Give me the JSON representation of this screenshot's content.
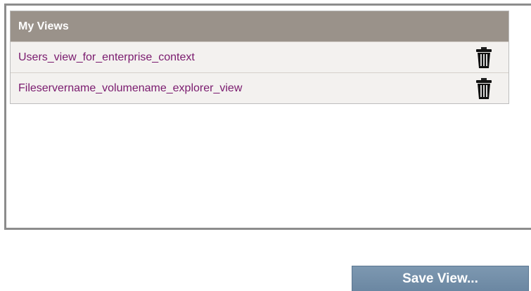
{
  "views": {
    "header": "My Views",
    "items": [
      {
        "name": "Users_view_for_enterprise_context",
        "icon": "trash-icon"
      },
      {
        "name": "Fileservername_volumename_explorer_view",
        "icon": "trash-icon"
      }
    ]
  },
  "actions": {
    "save_label": "Save View..."
  },
  "colors": {
    "header_bg": "#9a928a",
    "row_bg": "#f3f1ef",
    "link_text": "#7a1a6e",
    "button_bg": "#7590aa"
  }
}
